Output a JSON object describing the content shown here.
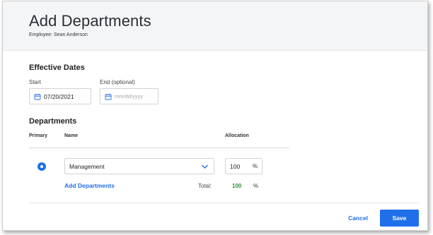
{
  "dialog": {
    "title": "Add Departments",
    "subtitle": "Employee: Sean Anderson"
  },
  "effective_dates": {
    "section_title": "Effective Dates",
    "start_label": "Start",
    "start_value": "07/20/2021",
    "end_label": "End (optional)",
    "end_placeholder": "mm/dd/yyyy",
    "icon": "calendar-icon"
  },
  "departments": {
    "section_title": "Departments",
    "columns": {
      "primary": "Primary",
      "name": "Name",
      "allocation": "Allocation"
    },
    "rows": [
      {
        "primary_selected": true,
        "name": "Management",
        "allocation": "100",
        "allocation_unit": "%"
      }
    ],
    "add_link": "Add Departments",
    "total_label": "Total:",
    "total_value": "100",
    "total_unit": "%"
  },
  "footer": {
    "cancel_label": "Cancel",
    "save_label": "Save"
  },
  "colors": {
    "accent": "#1f6feb",
    "total_ok": "#2e8b3a",
    "header_bg": "#f4f5f6"
  }
}
